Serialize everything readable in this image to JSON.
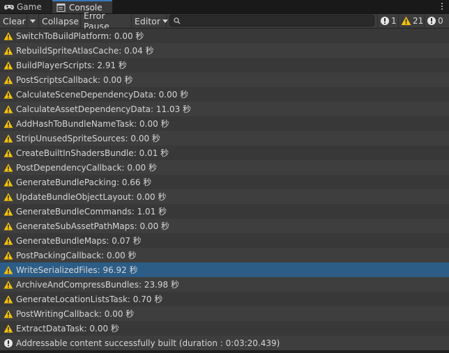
{
  "tabs": [
    {
      "label": "Game",
      "icon": "gamepad-icon"
    },
    {
      "label": "Console",
      "icon": "console-icon"
    }
  ],
  "toolbar": {
    "clear_label": "Clear",
    "collapse_label": "Collapse",
    "error_pause_label": "Error Pause",
    "editor_label": "Editor",
    "search_value": ""
  },
  "counts": {
    "log": "1",
    "warning": "21",
    "error": "0"
  },
  "colors": {
    "warning": "#f4c20d",
    "selected_row": "#2c5d87",
    "tab_accent": "#3a79bb"
  },
  "entries": [
    {
      "type": "warning",
      "text": "SwitchToBuildPlatform: 0.00 秒"
    },
    {
      "type": "warning",
      "text": "RebuildSpriteAtlasCache: 0.04 秒"
    },
    {
      "type": "warning",
      "text": "BuildPlayerScripts: 2.91 秒"
    },
    {
      "type": "warning",
      "text": "PostScriptsCallback: 0.00 秒"
    },
    {
      "type": "warning",
      "text": "CalculateSceneDependencyData: 0.00 秒"
    },
    {
      "type": "warning",
      "text": "CalculateAssetDependencyData: 11.03 秒"
    },
    {
      "type": "warning",
      "text": "AddHashToBundleNameTask: 0.00 秒"
    },
    {
      "type": "warning",
      "text": "StripUnusedSpriteSources: 0.00 秒"
    },
    {
      "type": "warning",
      "text": "CreateBuiltInShadersBundle: 0.01 秒"
    },
    {
      "type": "warning",
      "text": "PostDependencyCallback: 0.00 秒"
    },
    {
      "type": "warning",
      "text": "GenerateBundlePacking: 0.66 秒"
    },
    {
      "type": "warning",
      "text": "UpdateBundleObjectLayout: 0.00 秒"
    },
    {
      "type": "warning",
      "text": "GenerateBundleCommands: 1.01 秒"
    },
    {
      "type": "warning",
      "text": "GenerateSubAssetPathMaps: 0.00 秒"
    },
    {
      "type": "warning",
      "text": "GenerateBundleMaps: 0.07 秒"
    },
    {
      "type": "warning",
      "text": "PostPackingCallback: 0.00 秒"
    },
    {
      "type": "warning",
      "text": "WriteSerializedFiles: 96.92 秒",
      "selected": true
    },
    {
      "type": "warning",
      "text": "ArchiveAndCompressBundles: 23.98 秒"
    },
    {
      "type": "warning",
      "text": "GenerateLocationListsTask: 0.70 秒"
    },
    {
      "type": "warning",
      "text": "PostWritingCallback: 0.00 秒"
    },
    {
      "type": "warning",
      "text": "ExtractDataTask: 0.00 秒"
    },
    {
      "type": "info",
      "text": "Addressable content successfully built (duration : 0:03:20.439)"
    }
  ]
}
